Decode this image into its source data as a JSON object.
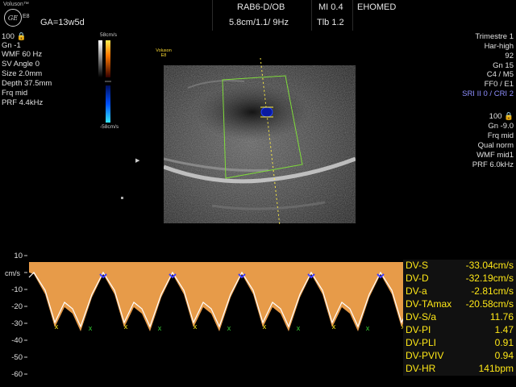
{
  "header": {
    "brand": "Voluson™",
    "logo": "GE",
    "model": "E8",
    "ga": "GA=13w5d",
    "probe": "RAB6-D/OB",
    "mi": "MI  0.4",
    "site": "EHOMED",
    "geometry": "5.8cm/1.1/ 9Hz",
    "tib": "Tlb  1.2"
  },
  "left_params": [
    "100 🔒",
    "Gn  -1",
    "WMF 60 Hz",
    "SV Angle  0",
    "Size  2.0mm",
    "Depth 37.5mm",
    "Frq mid",
    "PRF  4.4kHz"
  ],
  "color_bar": {
    "top_label": "58cm/s",
    "bottom_label": "-58cm/s"
  },
  "image_label": {
    "line1": "Voluson",
    "line2": "E8"
  },
  "right_params_top": [
    "Trimestre 1",
    "Har-high",
    "92",
    "Gn  15",
    "C4 / M5",
    "FF0 / E1"
  ],
  "sri_text": "SRI II 0 / CRI 2",
  "right_params_bottom": [
    "100 🔒",
    "Gn -9.0",
    "Frq mid",
    "Qual norm",
    "WMF mid1",
    "PRF  6.0kHz"
  ],
  "spectrum": {
    "unit": "cm/s",
    "ticks": [
      "10",
      "0",
      "-10",
      "-20",
      "-30",
      "-40",
      "-50",
      "-60"
    ]
  },
  "measurements": [
    {
      "label": "DV-S",
      "value": "-33.04cm/s"
    },
    {
      "label": "DV-D",
      "value": "-32.19cm/s"
    },
    {
      "label": "DV-a",
      "value": "-2.81cm/s"
    },
    {
      "label": "DV-TAmax",
      "value": "-20.58cm/s"
    },
    {
      "label": "DV-S/a",
      "value": "11.76"
    },
    {
      "label": "DV-PI",
      "value": "1.47"
    },
    {
      "label": "DV-PLI",
      "value": "0.91"
    },
    {
      "label": "DV-PVIV",
      "value": "0.94"
    },
    {
      "label": "DV-HR",
      "value": "141bpm"
    }
  ],
  "colors": {
    "measure_text": "#ffe817",
    "sri_text": "#8f8fff",
    "roi_box": "#7fdc3a",
    "spectrum_fill": "#f3a34d",
    "trace": "#ffffff",
    "marker_s": "#4040ff",
    "marker_a": "#ffe817",
    "marker_d": "#33cc33"
  }
}
